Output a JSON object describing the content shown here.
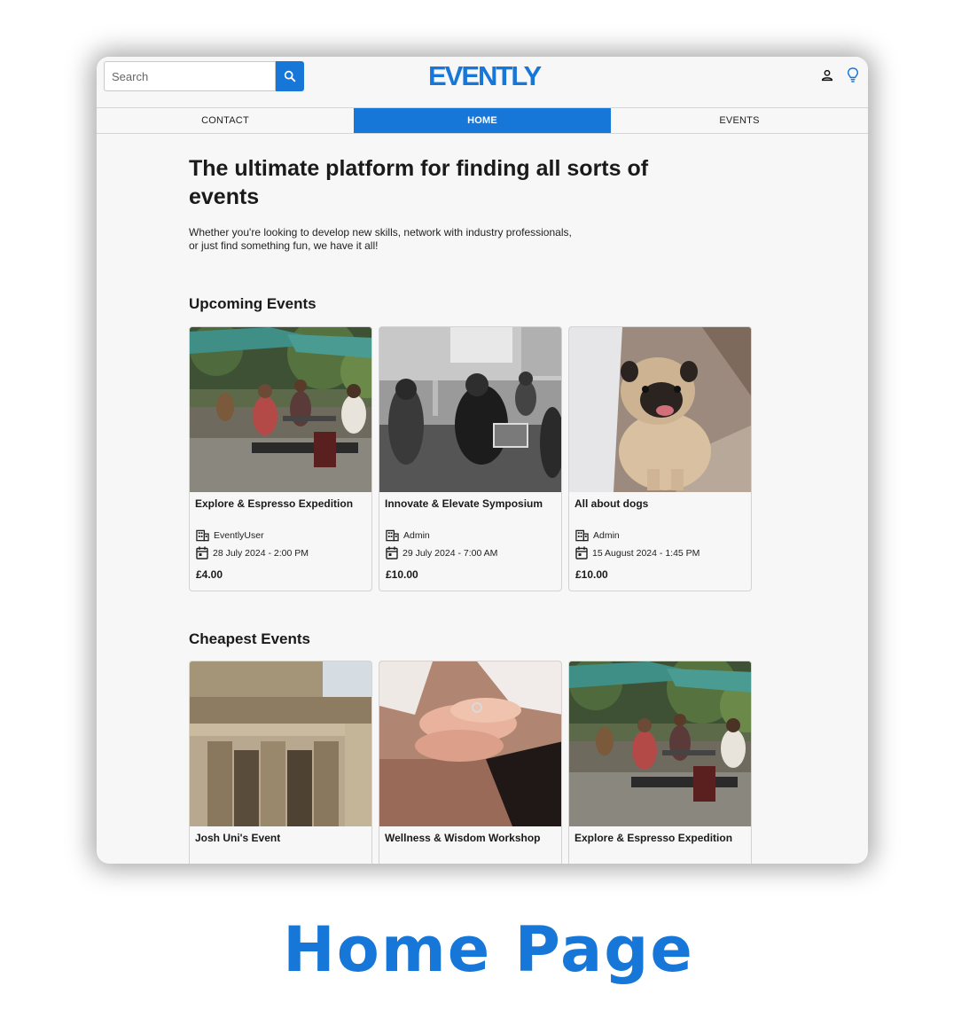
{
  "header": {
    "search_placeholder": "Search",
    "logo_text": "EVENTLY",
    "brand_color": "#1677d9"
  },
  "nav": {
    "tabs": [
      {
        "label": "CONTACT",
        "active": false
      },
      {
        "label": "HOME",
        "active": true
      },
      {
        "label": "EVENTS",
        "active": false
      }
    ]
  },
  "hero": {
    "title": "The ultimate platform for finding all sorts of events",
    "subtitle_line1": "Whether you're looking to develop new skills, network with industry professionals,",
    "subtitle_line2": "or just find something fun, we have it all!"
  },
  "upcoming": {
    "title": "Upcoming Events",
    "cards": [
      {
        "title": "Explore & Espresso Expedition",
        "organizer": "EventlyUser",
        "date": "28 July 2024 - 2:00 PM",
        "price": "£4.00",
        "image": "outdoor-cafe-photo"
      },
      {
        "title": "Innovate & Elevate Symposium",
        "organizer": "Admin",
        "date": "29 July 2024 - 7:00 AM",
        "price": "£10.00",
        "image": "meeting-photo"
      },
      {
        "title": "All about dogs",
        "organizer": "Admin",
        "date": "15 August 2024 - 1:45 PM",
        "price": "£10.00",
        "image": "pug-photo"
      }
    ]
  },
  "cheapest": {
    "title": "Cheapest Events",
    "cards": [
      {
        "title": "Josh Uni's Event",
        "image": "ruins-photo"
      },
      {
        "title": "Wellness & Wisdom Workshop",
        "image": "hands-photo"
      },
      {
        "title": "Explore & Espresso Expedition",
        "image": "outdoor-cafe-photo"
      }
    ]
  },
  "caption": "Home Page"
}
